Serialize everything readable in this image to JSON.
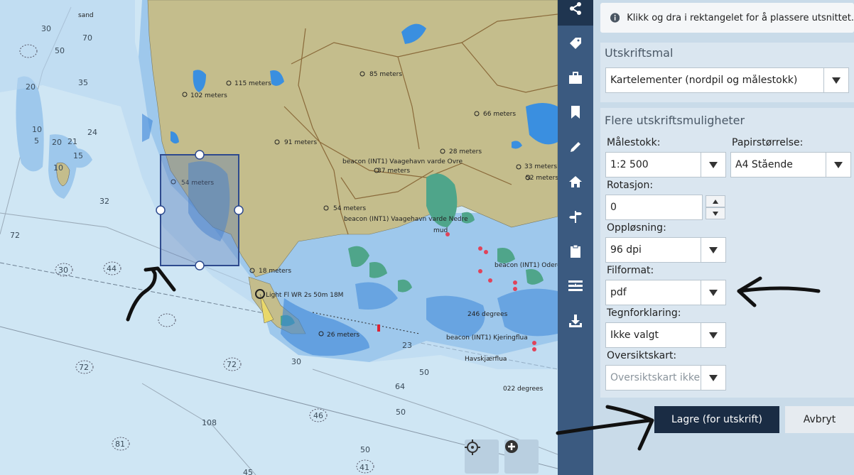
{
  "map": {
    "labels": {
      "sand": "sand",
      "m115": "115 meters",
      "m102": "102 meters",
      "m85": "85 meters",
      "m66": "66 meters",
      "m91": "91 meters",
      "m28": "28 meters",
      "beacon_vardeovre": "beacon (INT1) Vaagehavn varde Ovre",
      "m37": "37 meters",
      "m33": "33 meters",
      "m52": "52 meters",
      "m54a": "54 meters",
      "m54b": "54 meters",
      "beacon_nedre": "beacon (INT1) Vaagehavn varde Nedre",
      "mud": "mud",
      "m18": "18 meters",
      "light": "Light Fl WR 2s 50m 18M",
      "m26": "26 meters",
      "deg246": "246 degrees",
      "beacon_kjeringflua": "beacon (INT1) Kjeringflua",
      "havskjaerflua": "Havskjærflua",
      "deg022": "022 degrees",
      "beacon_oderen": "beacon (INT1) Oderen"
    },
    "depths": {
      "d30a": "30",
      "d70a": "70",
      "d50a": "50",
      "d35": "35",
      "d20a": "20",
      "d10a": "10",
      "d5": "5",
      "d20b": "20",
      "d21": "21",
      "d24": "24",
      "d15": "15",
      "d10b": "10",
      "d32": "32",
      "d72a": "72",
      "d30b": "30",
      "d44": "44",
      "d72b": "72",
      "d72c": "72",
      "d108": "108",
      "d81": "81",
      "d46": "46",
      "d64": "64",
      "d50b": "50",
      "d50c": "50",
      "d50d": "50",
      "d45": "45",
      "d41": "41",
      "d30c": "30",
      "d23": "23"
    },
    "buttons": {
      "locate_icon": "crosshair-icon",
      "zoom_icon": "plus-circle-icon"
    }
  },
  "toolbar": {
    "items": [
      {
        "name": "share",
        "icon": "share-icon",
        "active": true
      },
      {
        "name": "tag",
        "icon": "tag-icon",
        "active": false
      },
      {
        "name": "briefcase",
        "icon": "briefcase-icon",
        "active": false
      },
      {
        "name": "bookmark",
        "icon": "bookmark-icon",
        "active": false
      },
      {
        "name": "pencil",
        "icon": "pencil-icon",
        "active": false
      },
      {
        "name": "home",
        "icon": "home-icon",
        "active": false
      },
      {
        "name": "signpost",
        "icon": "signpost-icon",
        "active": false
      },
      {
        "name": "clipboard",
        "icon": "clipboard-icon",
        "active": false
      },
      {
        "name": "layers",
        "icon": "layers-icon",
        "active": false
      },
      {
        "name": "download",
        "icon": "download-icon",
        "active": false
      }
    ]
  },
  "panel": {
    "info_text": "Klikk og dra i rektangelet for å plassere utsnittet.",
    "template_heading": "Utskriftsmal",
    "template_value": "Kartelementer (nordpil og målestokk)",
    "more_heading": "Flere utskriftsmuligheter",
    "scale_label": "Målestokk:",
    "scale_value": "1:2 500",
    "paper_label": "Papirstørrelse:",
    "paper_value": "A4 Stående",
    "rotation_label": "Rotasjon:",
    "rotation_value": "0",
    "resolution_label": "Oppløsning:",
    "resolution_value": "96 dpi",
    "format_label": "Filformat:",
    "format_value": "pdf",
    "legend_label": "Tegnforklaring:",
    "legend_value": "Ikke valgt",
    "overview_label": "Oversiktskart:",
    "overview_value": "Oversiktskart ikke valgt",
    "save_button": "Lagre (for utskrift)",
    "cancel_button": "Avbryt"
  },
  "colors": {
    "land": "#c4bd8c",
    "sea": "#cfe6f4",
    "shallow": "#9ec8ec",
    "toolbar": "#3b5a80",
    "save": "#1a2c44"
  }
}
